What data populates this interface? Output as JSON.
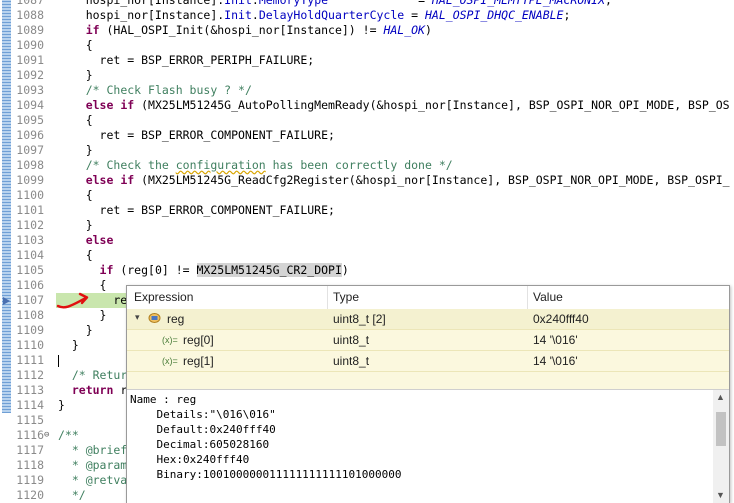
{
  "editor": {
    "lines": [
      {
        "n": "1087",
        "html": "    hospi_nor[Instance].<span class=\"fld\">Init</span>.<span class=\"fld\">MemoryType</span>             = <span class=\"mac\">HAL_OSPI_MEMTYPE_MACRONIX</span>;"
      },
      {
        "n": "1088",
        "html": "    hospi_nor[Instance].<span class=\"fld\">Init</span>.<span class=\"fld\">DelayHoldQuarterCycle</span> = <span class=\"mac\">HAL_OSPI_DHQC_ENABLE</span>;"
      },
      {
        "n": "1089",
        "html": "    <span class=\"kw\">if</span> (HAL_OSPI_Init(&amp;hospi_nor[Instance]) != <span class=\"mac\">HAL_OK</span>)"
      },
      {
        "n": "1090",
        "html": "    {"
      },
      {
        "n": "1091",
        "html": "      ret = BSP_ERROR_PERIPH_FAILURE;"
      },
      {
        "n": "1092",
        "html": "    }"
      },
      {
        "n": "1093",
        "html": "    <span class=\"cm\">/* Check Flash busy ? */</span>"
      },
      {
        "n": "1094",
        "html": "    <span class=\"kw\">else if</span> (MX25LM51245G_AutoPollingMemReady(&amp;hospi_nor[Instance], BSP_OSPI_NOR_OPI_MODE, BSP_OS"
      },
      {
        "n": "1095",
        "html": "    {"
      },
      {
        "n": "1096",
        "html": "      ret = BSP_ERROR_COMPONENT_FAILURE;"
      },
      {
        "n": "1097",
        "html": "    }"
      },
      {
        "n": "1098",
        "html": "    <span class=\"cm\">/* Check the <span class=\"sq\">configuration</span> has been correctly done */</span>"
      },
      {
        "n": "1099",
        "html": "    <span class=\"kw\">else if</span> (MX25LM51245G_ReadCfg2Register(&amp;hospi_nor[Instance], BSP_OSPI_NOR_OPI_MODE, BSP_OSPI_"
      },
      {
        "n": "1100",
        "html": "    {"
      },
      {
        "n": "1101",
        "html": "      ret = BSP_ERROR_COMPONENT_FAILURE;"
      },
      {
        "n": "1102",
        "html": "    }"
      },
      {
        "n": "1103",
        "html": "    <span class=\"kw\">else</span>"
      },
      {
        "n": "1104",
        "html": "    {"
      },
      {
        "n": "1105",
        "html": "      <span class=\"kw\">if</span> (reg[0] != <span class=\"hl-mac\">MX25LM51245G_CR2_DOPI</span>)"
      },
      {
        "n": "1106",
        "html": "      {"
      },
      {
        "n": "1107",
        "html": "        re"
      },
      {
        "n": "1108",
        "html": "      }"
      },
      {
        "n": "1109",
        "html": "    }"
      },
      {
        "n": "1110",
        "html": "  }"
      },
      {
        "n": "1111",
        "html": ""
      },
      {
        "n": "1112",
        "html": "  <span class=\"cm\">/* Retur</span>"
      },
      {
        "n": "1113",
        "html": "  <span class=\"kw\">return</span> r"
      },
      {
        "n": "1114",
        "html": "}"
      },
      {
        "n": "1115",
        "html": ""
      },
      {
        "n": "1116",
        "html": "<span class=\"cm\">/**</span>"
      },
      {
        "n": "1117",
        "html": "<span class=\"cm\">  * @brief</span>"
      },
      {
        "n": "1118",
        "html": "<span class=\"cm\">  * @param</span>"
      },
      {
        "n": "1119",
        "html": "<span class=\"cm\">  * @retva</span>"
      },
      {
        "n": "1120",
        "html": "<span class=\"cm\">  */</span>"
      }
    ]
  },
  "popup": {
    "headers": {
      "expression": "Expression",
      "type": "Type",
      "value": "Value"
    },
    "rows": [
      {
        "expr": "reg",
        "type": "uint8_t [2]",
        "value": "0x240fff40"
      },
      {
        "expr": "reg[0]",
        "type": "uint8_t",
        "value": "14 '\\016'"
      },
      {
        "expr": "reg[1]",
        "type": "uint8_t",
        "value": "14 '\\016'"
      }
    ],
    "var_icon": "(x)=",
    "details": [
      "Name : reg",
      "    Details:\"\\016\\016\"",
      "    Default:0x240fff40",
      "    Decimal:605028160",
      "    Hex:0x240fff40",
      "    Binary:100100000011111111111101000000"
    ]
  }
}
